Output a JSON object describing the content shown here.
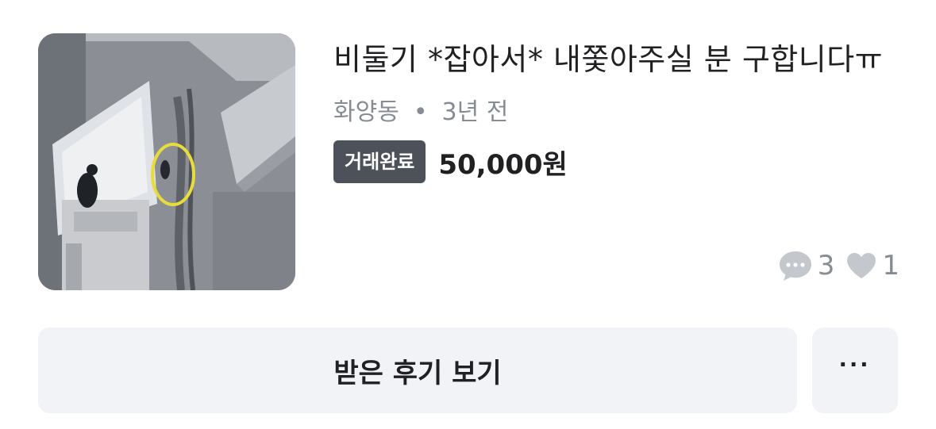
{
  "listing": {
    "title": "비둘기 *잡아서* 내쫓아주실 분 구합니다ㅠ",
    "location": "화양동",
    "separator": "•",
    "time_ago": "3년 전",
    "status_badge": "거래완료",
    "price": "50,000원",
    "chat_count": "3",
    "like_count": "1",
    "thumbnail_icon": "pigeon-photo"
  },
  "actions": {
    "review_button": "받은 후기 보기",
    "more_button": "···"
  },
  "colors": {
    "text_primary": "#212124",
    "text_secondary": "#868b94",
    "badge_bg": "#4d5159",
    "button_bg": "#f2f3f6",
    "icon_gray": "#c4c7cc"
  }
}
